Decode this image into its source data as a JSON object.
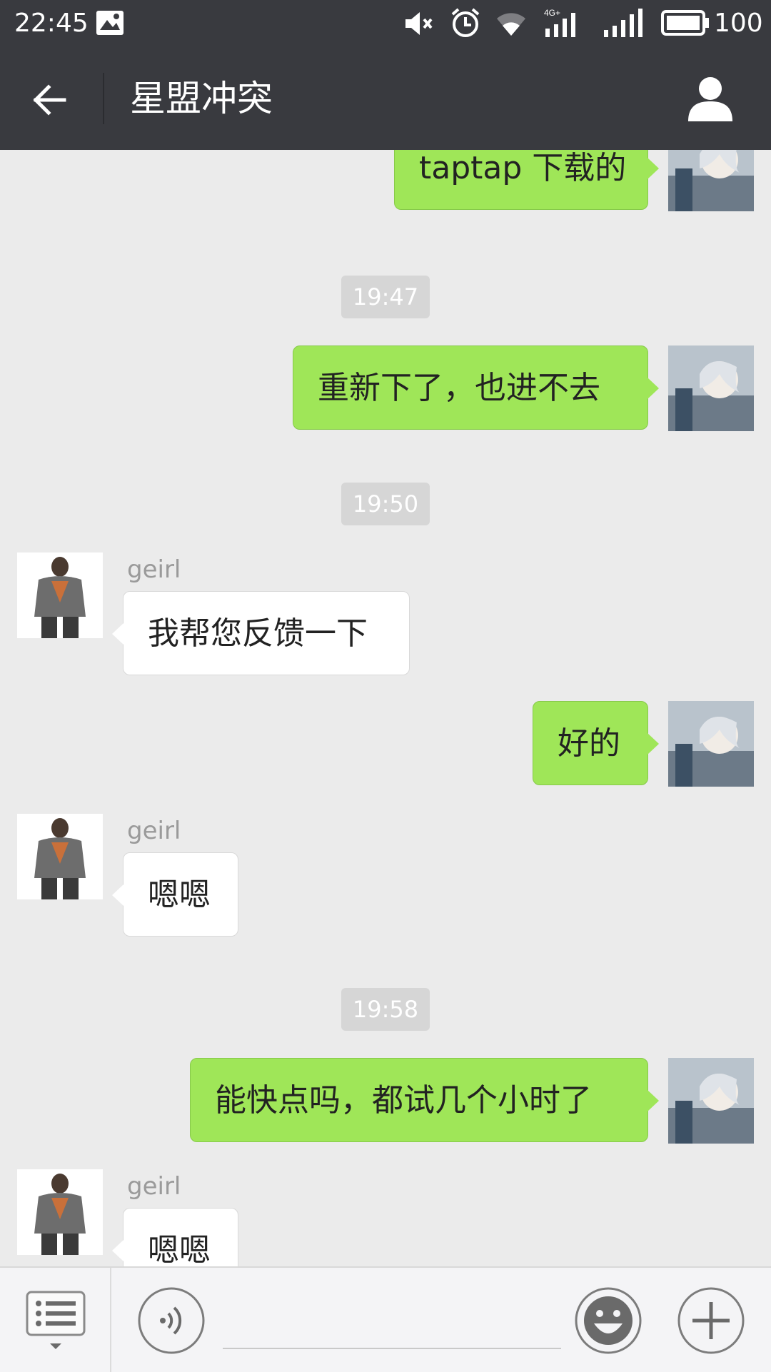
{
  "status_bar": {
    "time": "22:45",
    "battery": "100"
  },
  "header": {
    "title": "星盟冲突"
  },
  "messages": [
    {
      "text": "taptap 下载的"
    },
    {
      "time": "19:47"
    },
    {
      "text": "重新下了，也进不去"
    },
    {
      "time": "19:50"
    },
    {
      "sender": "geirl",
      "text": "我帮您反馈一下"
    },
    {
      "text": "好的"
    },
    {
      "sender": "geirl",
      "text": "嗯嗯"
    },
    {
      "time": "19:58"
    },
    {
      "text": "能快点吗，都试几个小时了"
    },
    {
      "sender": "geirl",
      "text": "嗯嗯"
    }
  ],
  "colors": {
    "header_bg": "#393a3f",
    "outgoing_bubble": "#9fe658",
    "incoming_bubble": "#ffffff",
    "chat_bg": "#ebebeb"
  },
  "icons": [
    "back-arrow-icon",
    "profile-icon",
    "menu-list-icon",
    "voice-icon",
    "emoji-icon",
    "plus-icon",
    "mute-icon",
    "alarm-icon",
    "wifi-icon",
    "signal-icon",
    "battery-icon",
    "image-notification-icon"
  ]
}
